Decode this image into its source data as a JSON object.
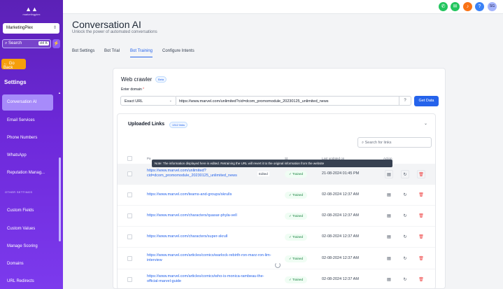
{
  "sidebar": {
    "logo_text": "marketingplex",
    "account": "MarketingPlex",
    "search_label": "Search",
    "search_shortcut": "ctrl K",
    "go_back": "Go Back",
    "settings_title": "Settings",
    "items": [
      {
        "label": "Conversation AI",
        "active": true
      },
      {
        "label": "Email Services",
        "active": false
      },
      {
        "label": "Phone Numbers",
        "active": false
      },
      {
        "label": "WhatsApp",
        "active": false
      },
      {
        "label": "Reputation Manag...",
        "active": false
      }
    ],
    "section_label": "OTHER SETTINGS",
    "other_items": [
      {
        "label": "Custom Fields"
      },
      {
        "label": "Custom Values"
      },
      {
        "label": "Manage Scoring"
      },
      {
        "label": "Domains"
      },
      {
        "label": "URL Redirects"
      }
    ]
  },
  "topbar": {
    "icons": [
      {
        "name": "phone-icon",
        "color": "#22c55e"
      },
      {
        "name": "megaphone-icon",
        "color": "#22c55e"
      },
      {
        "name": "bell-icon",
        "color": "#f97316"
      },
      {
        "name": "help-icon",
        "color": "#3b82f6"
      }
    ],
    "avatar_initials": "SG"
  },
  "header": {
    "title": "Conversation AI",
    "subtitle": "Unlock the power of automated conversations"
  },
  "tabs": [
    {
      "label": "Bot Settings",
      "active": false
    },
    {
      "label": "Bot Trial",
      "active": false
    },
    {
      "label": "Bot Training",
      "active": true
    },
    {
      "label": "Configure Intents",
      "active": false
    }
  ],
  "crawler": {
    "title": "Web crawler",
    "beta": "Beta",
    "enter_domain_label": "Enter domain",
    "required_mark": "*",
    "url_type": "Exact URL",
    "url_value": "https://www.marvel.com/unlimited?cid=dcom_promomodule_20230125_unlimited_news",
    "get_data": "Get Data"
  },
  "uploaded": {
    "title": "Uploaded Links",
    "count": "1312 links",
    "search_placeholder": "Search for links",
    "headers": {
      "page": "Pa",
      "status": "St",
      "last_updated": "Last updated on",
      "action": "Action"
    },
    "tooltip": "Note: The information displayed here is edited. Retraining the URL will revert it to the original information from the website",
    "rows": [
      {
        "url": "https://www.marvel.com/unlimited?cid=dcom_promomodule_20230125_unlimited_news",
        "edited": "Edited",
        "status": "Trained",
        "date": "21-08-2024 01:45 PM",
        "highlight": true
      },
      {
        "url": "https://www.marvel.com/teams-and-groups/skrulls",
        "status": "Trained",
        "date": "02-08-2024 12:37 AM"
      },
      {
        "url": "https://www.marvel.com/characters/quasar-phyla-vell",
        "status": "Trained",
        "date": "02-08-2024 12:37 AM"
      },
      {
        "url": "https://www.marvel.com/characters/super-skrull",
        "status": "Trained",
        "date": "02-08-2024 12:37 AM"
      },
      {
        "url": "https://www.marvel.com/articles/comics/warlock-rebirth-ron-marz-ron-lim-interview",
        "status": "Trained",
        "date": "02-08-2024 12:37 AM"
      },
      {
        "url": "https://www.marvel.com/articles/comics/who-is-monica-rambeau-the-official-marvel-guide",
        "status": "Trained",
        "date": "02-08-2024 12:37 AM"
      }
    ]
  }
}
